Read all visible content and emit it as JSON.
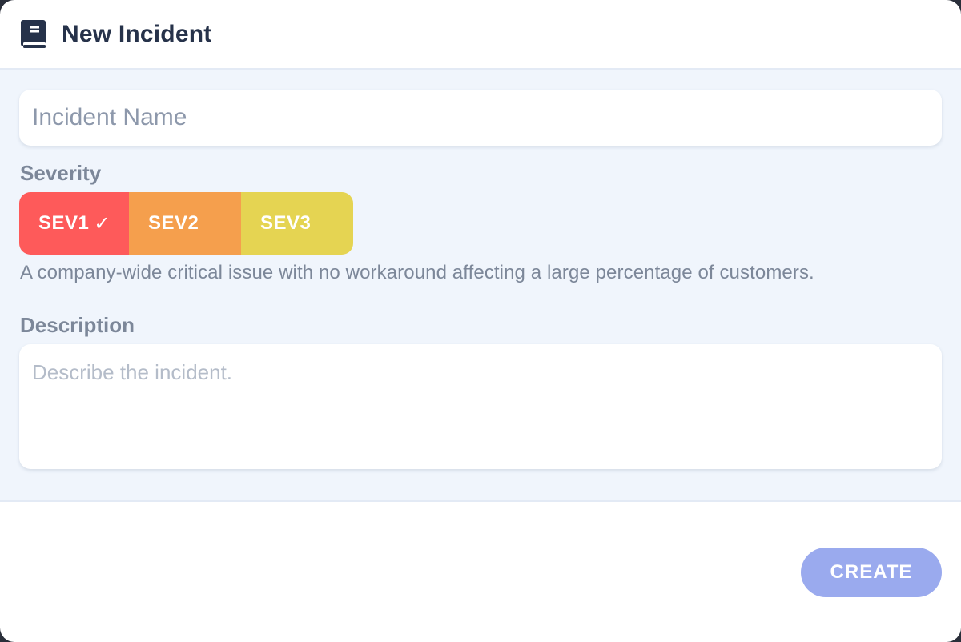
{
  "header": {
    "title": "New Incident",
    "icon": "book-icon"
  },
  "form": {
    "name_placeholder": "Incident Name",
    "name_value": "",
    "severity_label": "Severity",
    "severity_options": [
      {
        "label": "SEV1",
        "color": "#fe5a5a",
        "selected": true
      },
      {
        "label": "SEV2",
        "color": "#f59f4d",
        "selected": false
      },
      {
        "label": "SEV3",
        "color": "#e5d452",
        "selected": false
      }
    ],
    "severity_check": "✓",
    "severity_help": "A company-wide critical issue with no workaround affecting a large percentage of customers.",
    "description_label": "Description",
    "description_placeholder": "Describe the incident.",
    "description_value": ""
  },
  "footer": {
    "create_label": "CREATE",
    "create_color": "#9aaaee"
  }
}
